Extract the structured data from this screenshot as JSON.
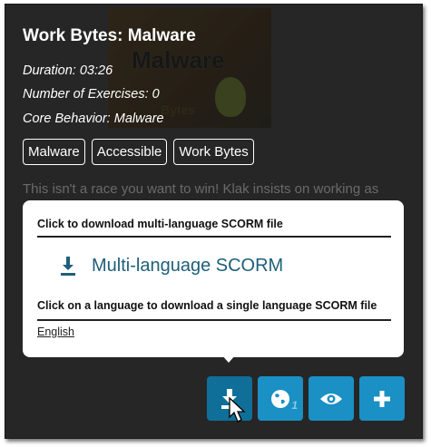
{
  "card": {
    "title": "Work Bytes: Malware",
    "duration": "Duration: 03:26",
    "exercises": "Number of Exercises: 0",
    "core_behavior": "Core Behavior: Malware",
    "thumbnail_word": "Malware",
    "thumbnail_sub": "Bytes",
    "tags": [
      "Malware",
      "Accessible",
      "Work Bytes"
    ],
    "description": "This isn't a race you want to win! Klak insists on working as"
  },
  "popup": {
    "multi_heading": "Click to download multi-language SCORM file",
    "multi_link": "Multi-language SCORM",
    "single_heading": "Click on a language to download a single language SCORM file",
    "languages": [
      "English"
    ]
  },
  "actions": {
    "languages_count": "1",
    "colors": {
      "primary": "#1a90c4",
      "active": "#0f6f99"
    }
  }
}
